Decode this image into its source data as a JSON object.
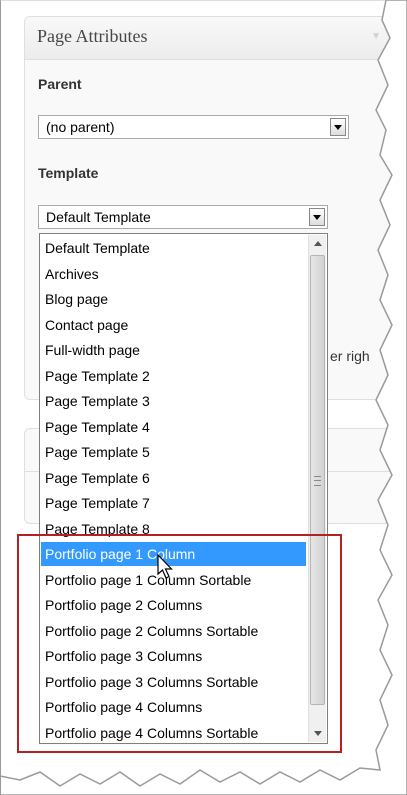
{
  "panel": {
    "title": "Page Attributes",
    "parent_label": "Parent",
    "parent_value": "(no parent)",
    "template_label": "Template",
    "template_value": "Default Template",
    "partial_text": "er righ"
  },
  "dropdown": {
    "options": [
      "Default Template",
      "Archives",
      "Blog page",
      "Contact page",
      "Full-width page",
      "Page Template 2",
      "Page Template 3",
      "Page Template 4",
      "Page Template 5",
      "Page Template 6",
      "Page Template 7",
      "Page Template 8",
      "Portfolio page 1 Column",
      "Portfolio page 1 Column Sortable",
      "Portfolio page 2 Columns",
      "Portfolio page 2 Columns Sortable",
      "Portfolio page 3 Columns",
      "Portfolio page 3 Columns Sortable",
      "Portfolio page 4 Columns",
      "Portfolio page 4 Columns Sortable"
    ],
    "selected_index": 12
  },
  "colors": {
    "selection": "#3399ff",
    "highlight_box": "#b22222"
  }
}
